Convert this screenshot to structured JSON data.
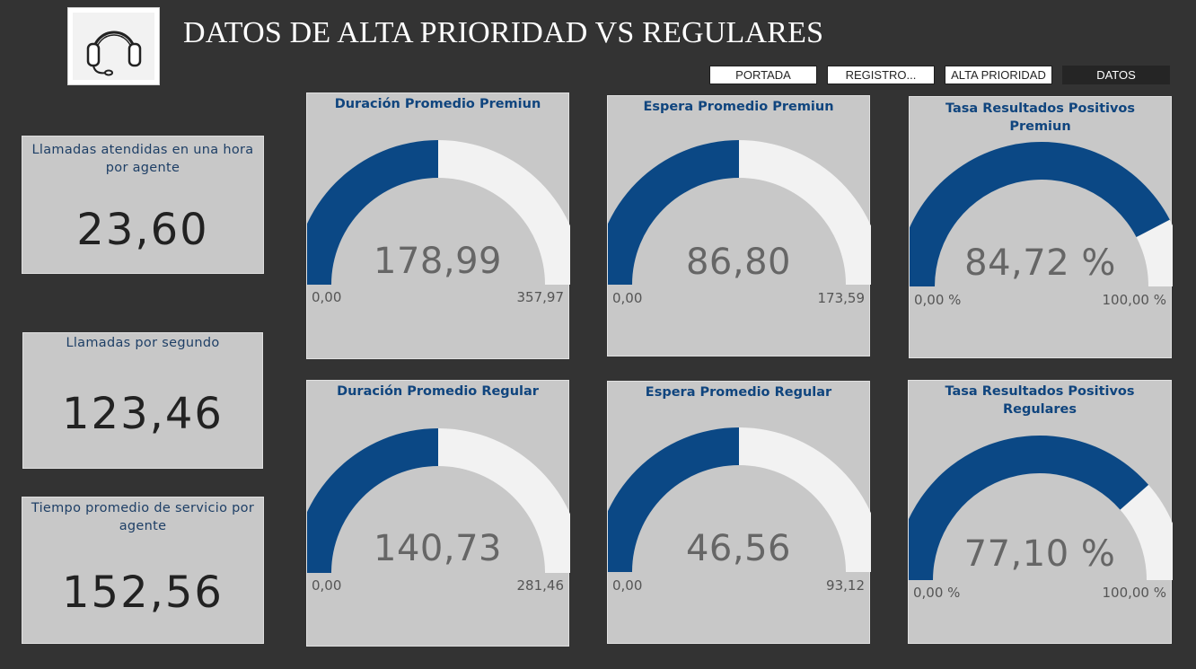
{
  "header": {
    "title": "DATOS DE ALTA PRIORIDAD VS REGULARES",
    "logo_icon": "headset-icon"
  },
  "nav": {
    "portada": "PORTADA",
    "registro": "REGISTRO...",
    "alta_prioridad": "ALTA PRIORIDAD",
    "datos": "DATOS"
  },
  "kpis": [
    {
      "label": "Llamadas atendidas en una hora por agente",
      "value": "23,60"
    },
    {
      "label": "Llamadas por segundo",
      "value": "123,46"
    },
    {
      "label": "Tiempo promedio de servicio por agente",
      "value": "152,56"
    }
  ],
  "gauges": [
    {
      "title": "Duración Promedio Premiun",
      "value": "178,99",
      "min": "0,00",
      "max": "357,97",
      "fraction": 0.5
    },
    {
      "title": "Espera Promedio Premiun",
      "value": "86,80",
      "min": "0,00",
      "max": "173,59",
      "fraction": 0.5
    },
    {
      "title": "Tasa Resultados Positivos Premiun",
      "value": "84,72 %",
      "min": "0,00 %",
      "max": "100,00 %",
      "fraction": 0.8472
    },
    {
      "title": "Duración Promedio Regular",
      "value": "140,73",
      "min": "0,00",
      "max": "281,46",
      "fraction": 0.5
    },
    {
      "title": "Espera Promedio Regular",
      "value": "46,56",
      "min": "0,00",
      "max": "93,12",
      "fraction": 0.5
    },
    {
      "title": "Tasa Resultados Positivos Regulares",
      "value": "77,10 %",
      "min": "0,00 %",
      "max": "100,00 %",
      "fraction": 0.771
    }
  ],
  "colors": {
    "background": "#333333",
    "card": "#c8c8c8",
    "gauge_fill": "#0b4885",
    "gauge_track": "#f2f2f2",
    "title_blue": "#10457e"
  }
}
